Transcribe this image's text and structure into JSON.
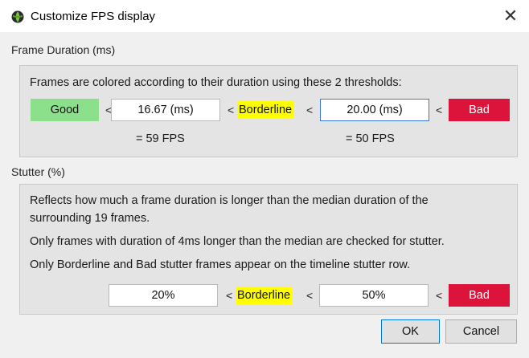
{
  "window": {
    "title": "Customize FPS display",
    "close_glyph": "✕",
    "app_icon": "globe-icon"
  },
  "frame_duration": {
    "section_label": "Frame Duration (ms)",
    "description": "Frames are colored according to their duration using these 2 thresholds:",
    "good_label": "Good",
    "lt_symbol": "<",
    "threshold1_value": "16.67 (ms)",
    "borderline_label": "Borderline",
    "threshold2_value": "20.00 (ms)",
    "bad_label": "Bad",
    "fps1_text": "= 59  FPS",
    "fps2_text": "= 50  FPS"
  },
  "stutter": {
    "section_label": "Stutter (%)",
    "line1": "Reflects how much a frame duration is longer than the median duration of the",
    "line2": "surrounding 19 frames.",
    "line3": "Only frames with duration of 4ms longer than the median are checked for stutter.",
    "line4": "Only Borderline and Bad stutter frames appear on the timeline stutter row.",
    "threshold1_value": "20%",
    "borderline_label": "Borderline",
    "threshold2_value": "50%",
    "bad_label": "Bad",
    "lt_symbol": "<"
  },
  "buttons": {
    "ok_label": "OK",
    "cancel_label": "Cancel"
  },
  "colors": {
    "good": "#8ce08c",
    "borderline": "#ffff00",
    "bad": "#dc143c",
    "focus_border": "#3c78d8"
  }
}
